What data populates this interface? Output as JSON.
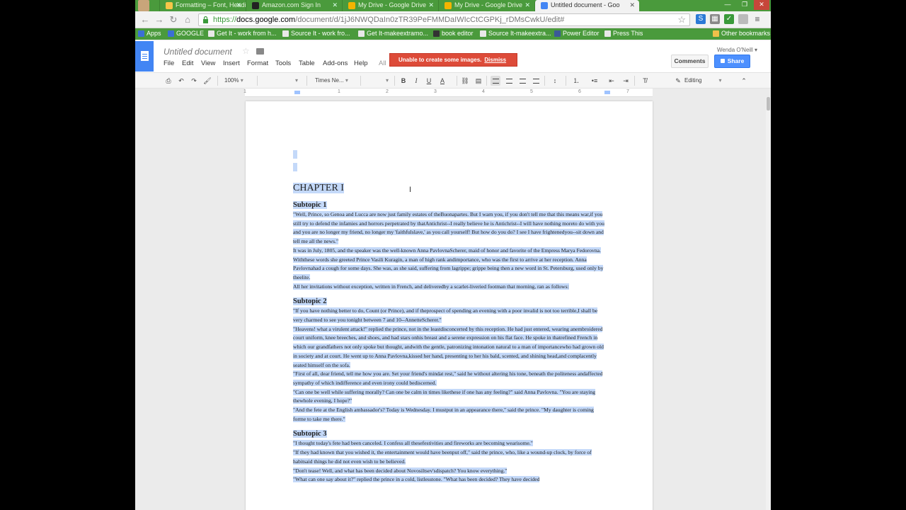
{
  "browser": {
    "tabs": [
      {
        "label": "Formatting – Font, Headi",
        "active": false
      },
      {
        "label": "Amazon.com Sign In",
        "active": false
      },
      {
        "label": "My Drive - Google Drive",
        "active": false
      },
      {
        "label": "My Drive - Google Drive",
        "active": false
      },
      {
        "label": "Untitled document - Goo",
        "active": true
      }
    ],
    "url_scheme": "https://",
    "url_host": "docs.google.com",
    "url_path": "/document/d/1jJ6NWQDaIn0zTR39PeFMMDaIWIcCtCGPKj_rDMsCwkU/edit#",
    "bookmarks": [
      {
        "label": "Apps",
        "icon": "apps-grid-icon"
      },
      {
        "label": "GOOGLE",
        "icon": "google-icon"
      },
      {
        "label": "Get It - work from h...",
        "icon": "page-icon"
      },
      {
        "label": "Source It - work fro...",
        "icon": "page-icon"
      },
      {
        "label": "Get It-makeextramo...",
        "icon": "page-icon"
      },
      {
        "label": "book editor",
        "icon": "page-icon"
      },
      {
        "label": "Source It-makeextra...",
        "icon": "page-icon"
      },
      {
        "label": "Power Editor",
        "icon": "facebook-icon"
      },
      {
        "label": "Press This",
        "icon": "page-icon"
      },
      {
        "label": "Other bookmarks",
        "icon": "folder-icon"
      }
    ]
  },
  "docs": {
    "title": "Untitled document",
    "menus": [
      "File",
      "Edit",
      "View",
      "Insert",
      "Format",
      "Tools",
      "Table",
      "Add-ons",
      "Help",
      "All"
    ],
    "alert_text": "Unable to create some images.",
    "alert_dismiss": "Dismiss",
    "user_name": "Wenda O'Neill ▾",
    "comments_label": "Comments",
    "share_label": "Share",
    "zoom": "100%",
    "font": "Times Ne...",
    "mode": "Editing",
    "ruler_numbers": [
      "1",
      "1",
      "2",
      "3",
      "4",
      "5",
      "6",
      "7"
    ]
  },
  "document": {
    "chapter": "CHAPTER I",
    "sections": [
      {
        "heading": "Subtopic 1",
        "paragraphs": [
          "\"Well, Prince, so Genoa and Lucca are now just family estates of theBuonapartes. But I warn you, if you don't tell me that this means war,if you still try to defend the infamies and horrors perpetrated by thatAntichrist--I really believe he is Antichrist--I will have nothing moreto do with you and you are no longer my friend, no longer my 'faithfulslave,' as you call yourself! But how do you do? I see I have frightenedyou--sit down and tell me all the news.\"",
          "It was in July, 1805, and the speaker was the well-known Anna PavlovnaScherer, maid of honor and favorite of the Empress Marya Fedorovna. Withthese words she greeted Prince Vasili Kuragin, a man of high rank andimportance, who was the first to arrive at her reception. Anna Pavlovnahad a cough for some days. She was, as she said, suffering from lagrippe; grippe being then a new word in St. Petersburg, used only by theelite.",
          "All her invitations without exception, written in French, and deliveredby a scarlet-liveried footman that morning, ran as follows:"
        ]
      },
      {
        "heading": "Subtopic 2",
        "paragraphs": [
          "\"If you have nothing better to do, Count (or Prince), and if theprospect of spending an evening with a poor invalid is not too terrible,I shall be very charmed to see you tonight between 7 and 10--AnnetteScherer.\"",
          "\"Heavens! what a virulent attack!\" replied the prince, not in the leastdisconcerted by this reception. He had just entered, wearing anembroidered court uniform, knee breeches, and shoes, and had stars onhis breast and a serene expression on his flat face. He spoke in thatrefined French in which our grandfathers not only spoke but thought, andwith the gentle, patronizing intonation natural to a man of importancewho had grown old in society and at court. He went up to Anna Pavlovna,kissed her hand, presenting to her his bald, scented, and shining head,and complacently seated himself on the sofa.",
          "\"First of all, dear friend, tell me how you are. Set your friend's mindat rest,\" said he without altering his tone, beneath the politeness andaffected sympathy of which indifference and even irony could bediscerned.",
          "\"Can one be well while suffering morally? Can one be calm in times likethese if one has any feeling?\" said Anna Pavlovna. \"You are staying thewhole evening, I hope?\"",
          "\"And the fete at the English ambassador's? Today is Wednesday. I mustput in an appearance there,\" said the prince. \"My daughter is coming forme to take me there.\""
        ]
      },
      {
        "heading": "Subtopic 3",
        "paragraphs": [
          "\"I thought today's fete had been canceled. I confess all thesefestivities and fireworks are becoming wearisome.\"",
          "\"If they had known that you wished it, the entertainment would have beenput off,\" said the prince, who, like a wound-up clock, by force of habitsaid things he did not even wish to be believed.",
          "\"Don't tease! Well, and what has been decided about Novosiltsev'sdispatch? You know everything.\"",
          "\"What can one say about it?\" replied the prince in a cold, listlesstone. \"What has been decided? They have decided"
        ]
      }
    ]
  },
  "colors": {
    "chrome_green": "#4a9a3c",
    "docs_blue": "#4285f4",
    "selection": "#c4d9f9",
    "alert_red": "#dd4b39",
    "share_blue": "#4d90fe"
  }
}
